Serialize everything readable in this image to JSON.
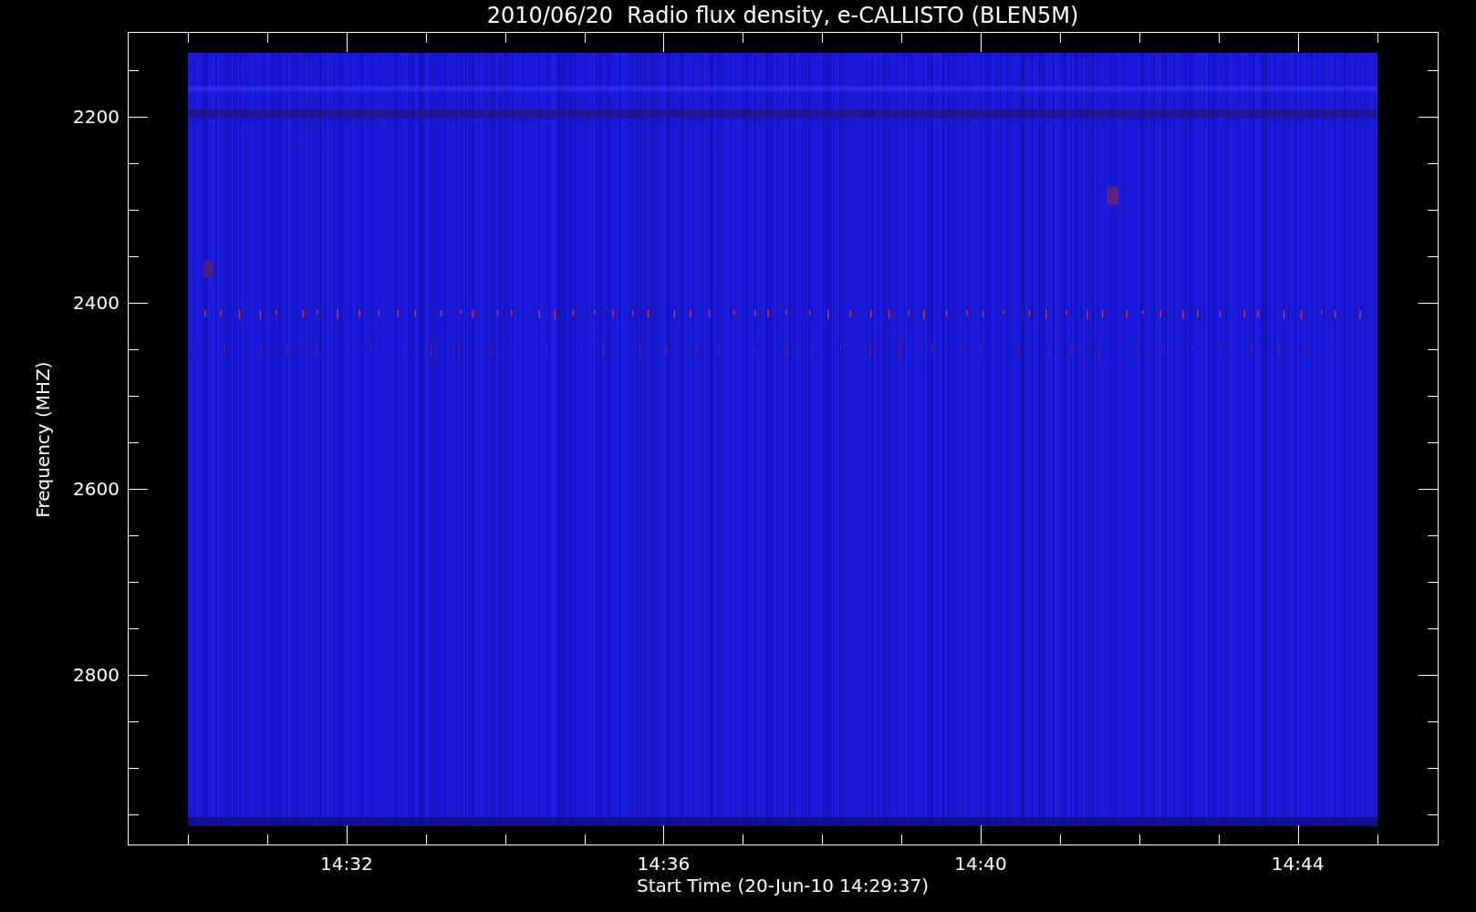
{
  "chart": {
    "title": "2010/06/20  Radio flux density, e-CALLISTO (BLEN5M)",
    "xlabel": "Start Time (20-Jun-10 14:29:37)",
    "ylabel": "Frequency (MHZ)",
    "ytick_labels": [
      "2200",
      "2400",
      "2600",
      "2800"
    ],
    "xtick_labels": [
      "14:32",
      "14:36",
      "14:40",
      "14:44"
    ]
  }
}
